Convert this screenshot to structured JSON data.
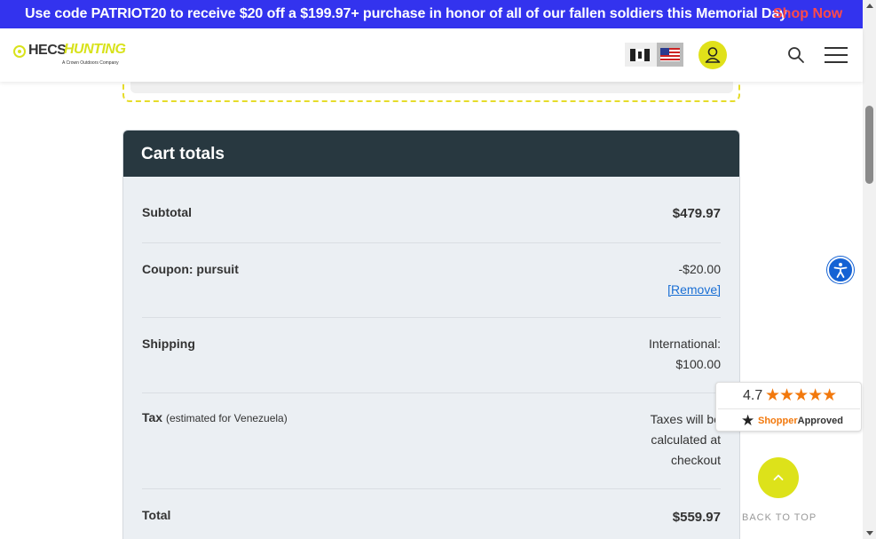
{
  "promo": {
    "text": "Use code PATRIOT20 to receive $20 off a $199.97+ purchase in honor of all of our fallen soldiers this Memorial Day",
    "link": "Shop Now"
  },
  "header": {
    "logo_text": "HECS",
    "logo_accent": "HUNTING",
    "logo_tagline": "A Crown Outdoors Company",
    "icons": [
      "canada-flag-icon",
      "us-flag-icon",
      "user-icon",
      "search-icon",
      "menu-icon"
    ]
  },
  "cart_totals": {
    "title": "Cart totals",
    "subtotal_label": "Subtotal",
    "subtotal_value": "$479.97",
    "coupon_label": "Coupon: pursuit",
    "coupon_value": "-$20.00",
    "coupon_remove": "[Remove]",
    "shipping_label": "Shipping",
    "shipping_method": "International:",
    "shipping_value": "$100.00",
    "tax_label": "Tax",
    "tax_note": "(estimated for Venezuela)",
    "tax_value_line1": "Taxes will be",
    "tax_value_line2": "calculated at",
    "tax_value_line3": "checkout",
    "total_label": "Total",
    "total_value": "$559.97"
  },
  "shopper_approved": {
    "rating": "4.7",
    "stars": "★★★★★",
    "brand_prefix": "Shopper",
    "brand_suffix": "Approved"
  },
  "back_to_top": {
    "label": "BACK TO TOP"
  },
  "colors": {
    "promo_bg": "#3333ee",
    "promo_link": "#ff4a4a",
    "brand_yellow": "#dde21a",
    "cart_header": "#283840",
    "link_blue": "#1a6fd4",
    "star_orange": "#f2780c"
  }
}
